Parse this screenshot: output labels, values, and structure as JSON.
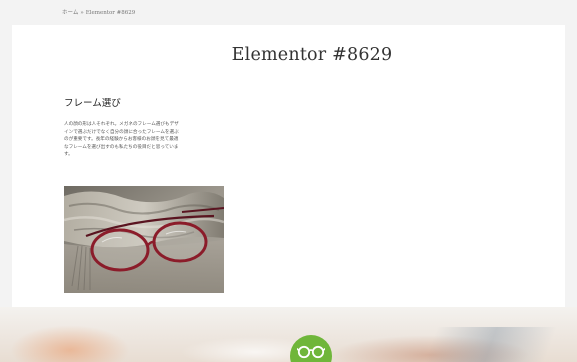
{
  "breadcrumb": {
    "home": "ホーム",
    "separator": "»",
    "current": "Elementor #8629"
  },
  "page": {
    "title": "Elementor #8629"
  },
  "section": {
    "heading": "フレーム選び",
    "body_lines": [
      "人の顔の形は人それぞれ。メガネのフレーム選びもデザ",
      "インで選ぶだけでなく自分の顔に合ったフレームを選ぶ",
      "のが重要です。長年の経験からお客様のお顔を見て最適",
      "なフレームを選び出すのも私たちの役目だと思っていま",
      "す。"
    ]
  },
  "colors": {
    "logo_green": "#6fb63a",
    "frame_red": "#8b1c2a"
  },
  "icons": {
    "logo": "glasses-logo-icon"
  }
}
